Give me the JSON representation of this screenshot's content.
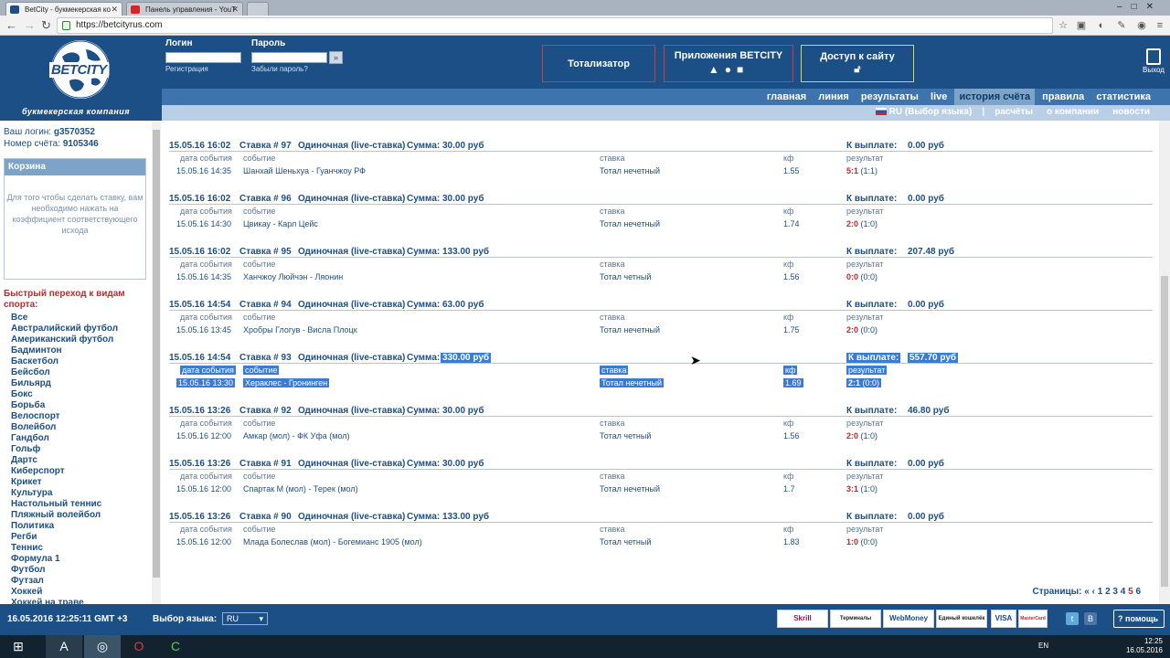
{
  "browser": {
    "tabs": [
      {
        "label": "BetCity - букмекерская ко",
        "active": true
      },
      {
        "label": "Панель управления - YouT",
        "active": false
      }
    ],
    "url": "https://betcityrus.com"
  },
  "header": {
    "logo": "BETCITY",
    "logo_sub": "букмекерская компания",
    "login_label": "Логин",
    "password_label": "Пароль",
    "register_link": "Регистрация",
    "forgot_link": "Забыли пароль?",
    "go_button": "»",
    "totalizator": "Тотализатор",
    "apps": "Приложения BETCITY",
    "access": "Доступ к сайту",
    "exit": "Выход"
  },
  "nav": {
    "main": [
      "главная",
      "линия",
      "результаты",
      "live",
      "история счёта",
      "правила",
      "статистика"
    ],
    "active_index": 4,
    "lang": "RU (Выбор языка)",
    "secondary": [
      "расчёты",
      "о компании",
      "новости"
    ]
  },
  "account": {
    "login_label": "Ваш логин:",
    "login": "g3570352",
    "number_label": "Номер счёта:",
    "number": "9105346"
  },
  "basket": {
    "title": "Корзина",
    "text": "Для того чтобы сделать ставку, вам необходимо нажать на коэффициент соответствующего исхода"
  },
  "quick": {
    "title": "Быстрый переход к видам спорта:",
    "sports": [
      "Все",
      "Австралийский футбол",
      "Американский футбол",
      "Бадминтон",
      "Баскетбол",
      "Бейсбол",
      "Бильярд",
      "Бокс",
      "Борьба",
      "Велоспорт",
      "Волейбол",
      "Гандбол",
      "Гольф",
      "Дартс",
      "Киберспорт",
      "Крикет",
      "Культура",
      "Настольный теннис",
      "Пляжный волейбол",
      "Политика",
      "Регби",
      "Теннис",
      "Формула 1",
      "Футбол",
      "Футзал",
      "Хоккей",
      "Хоккей на траве"
    ]
  },
  "labels": {
    "date": "дата события",
    "event": "событие",
    "stake": "ставка",
    "coef": "кф",
    "result": "результат",
    "payout": "К выплате:"
  },
  "bets": [
    {
      "datetime": "15.05.16 16:02",
      "id": "Ставка # 97",
      "type": "Одиночная (live-ставка)",
      "sum": "Сумма: 30.00 руб",
      "payout": "0.00 руб",
      "event_date": "15.05.16 14:35",
      "event": "Шанхай Шеньхуа - Гуанчжоу РФ",
      "stake": "Тотал нечетный",
      "coef": "1.55",
      "score": "5:1",
      "half": "(1:1)"
    },
    {
      "datetime": "15.05.16 16:02",
      "id": "Ставка # 96",
      "type": "Одиночная (live-ставка)",
      "sum": "Сумма: 30.00 руб",
      "payout": "0.00 руб",
      "event_date": "15.05.16 14:30",
      "event": "Цвикау - Карл Цейс",
      "stake": "Тотал нечетный",
      "coef": "1.74",
      "score": "2:0",
      "half": "(1:0)"
    },
    {
      "datetime": "15.05.16 16:02",
      "id": "Ставка # 95",
      "type": "Одиночная (live-ставка)",
      "sum": "Сумма: 133.00 руб",
      "payout": "207.48 руб",
      "event_date": "15.05.16 14:35",
      "event": "Ханчжоу Люйчэн - Ляонин",
      "stake": "Тотал четный",
      "coef": "1.56",
      "score": "0:0",
      "half": "(0:0)"
    },
    {
      "datetime": "15.05.16 14:54",
      "id": "Ставка # 94",
      "type": "Одиночная (live-ставка)",
      "sum": "Сумма: 63.00 руб",
      "payout": "0.00 руб",
      "event_date": "15.05.16 13:45",
      "event": "Хробры Глогув - Висла Плоцк",
      "stake": "Тотал нечетный",
      "coef": "1.75",
      "score": "2:0",
      "half": "(0:0)"
    },
    {
      "datetime": "15.05.16 14:54",
      "id": "Ставка # 93",
      "type": "Одиночная (live-ставка)",
      "sum": "Сумма:",
      "sum_value": "330.00 руб",
      "payout": "557.70 руб",
      "event_date": "15.05.16 13:30",
      "event": "Хераклес - Гронинген",
      "stake": "Тотал нечетный",
      "coef": "1.69",
      "score": "2:1",
      "half": "(0:0)",
      "selected": true
    },
    {
      "datetime": "15.05.16 13:26",
      "id": "Ставка # 92",
      "type": "Одиночная (live-ставка)",
      "sum": "Сумма: 30.00 руб",
      "payout": "46.80 руб",
      "event_date": "15.05.16 12:00",
      "event": "Амкар (мол) - ФК Уфа (мол)",
      "stake": "Тотал четный",
      "coef": "1.56",
      "score": "2:0",
      "half": "(1:0)"
    },
    {
      "datetime": "15.05.16 13:26",
      "id": "Ставка # 91",
      "type": "Одиночная (live-ставка)",
      "sum": "Сумма: 30.00 руб",
      "payout": "0.00 руб",
      "event_date": "15.05.16 12:00",
      "event": "Спартак М (мол) - Терек (мол)",
      "stake": "Тотал нечетный",
      "coef": "1.7",
      "score": "3:1",
      "half": "(1:0)"
    },
    {
      "datetime": "15.05.16 13:26",
      "id": "Ставка # 90",
      "type": "Одиночная (live-ставка)",
      "sum": "Сумма: 133.00 руб",
      "payout": "0.00 руб",
      "event_date": "15.05.16 12:00",
      "event": "Млада Болеслав (мол) - Богемианс 1905 (мол)",
      "stake": "Тотал четный",
      "coef": "1.83",
      "score": "1:0",
      "half": "(0:0)"
    }
  ],
  "pager": {
    "label": "Страницы:",
    "arrows": "« ‹",
    "pages": [
      "1",
      "2",
      "3",
      "4",
      "5",
      "6"
    ],
    "current": "5"
  },
  "footer": {
    "datetime": "16.05.2016  12:25:11  GMT +3",
    "lang_label": "Выбор языка:",
    "lang_value": "RU",
    "payments": [
      "Skrill",
      "Терминалы Россия",
      "WebMoney",
      "Единый кошелёк",
      "VISA",
      "MasterCard"
    ],
    "help": "помощь"
  },
  "taskbar": {
    "lang": "EN",
    "time": "12:25",
    "date": "16.05.2016"
  }
}
